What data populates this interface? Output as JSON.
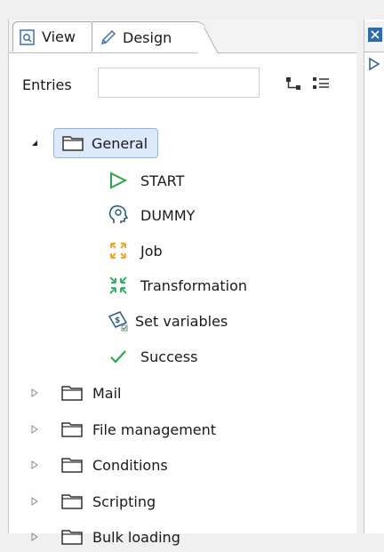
{
  "tabs": {
    "view_label": "View",
    "design_label": "Design"
  },
  "entries": {
    "label": "Entries",
    "search_value": ""
  },
  "tree": {
    "general": {
      "label": "General",
      "children": [
        {
          "label": "START",
          "icon": "start-triangle-icon"
        },
        {
          "label": "DUMMY",
          "icon": "dummy-head-icon"
        },
        {
          "label": "Job",
          "icon": "job-arrows-icon"
        },
        {
          "label": "Transformation",
          "icon": "transformation-arrows-icon"
        },
        {
          "label": "Set variables",
          "icon": "set-variables-icon"
        },
        {
          "label": "Success",
          "icon": "success-check-icon"
        }
      ]
    },
    "folders": [
      {
        "label": "Mail"
      },
      {
        "label": "File management"
      },
      {
        "label": "Conditions"
      },
      {
        "label": "Scripting"
      },
      {
        "label": "Bulk loading"
      }
    ]
  },
  "colors": {
    "selection_bg": "#dbe9fb",
    "selection_border": "#8fb4e6",
    "start_green": "#2aa84a",
    "job_orange": "#f5a623",
    "transform_green": "#2fb36b"
  }
}
